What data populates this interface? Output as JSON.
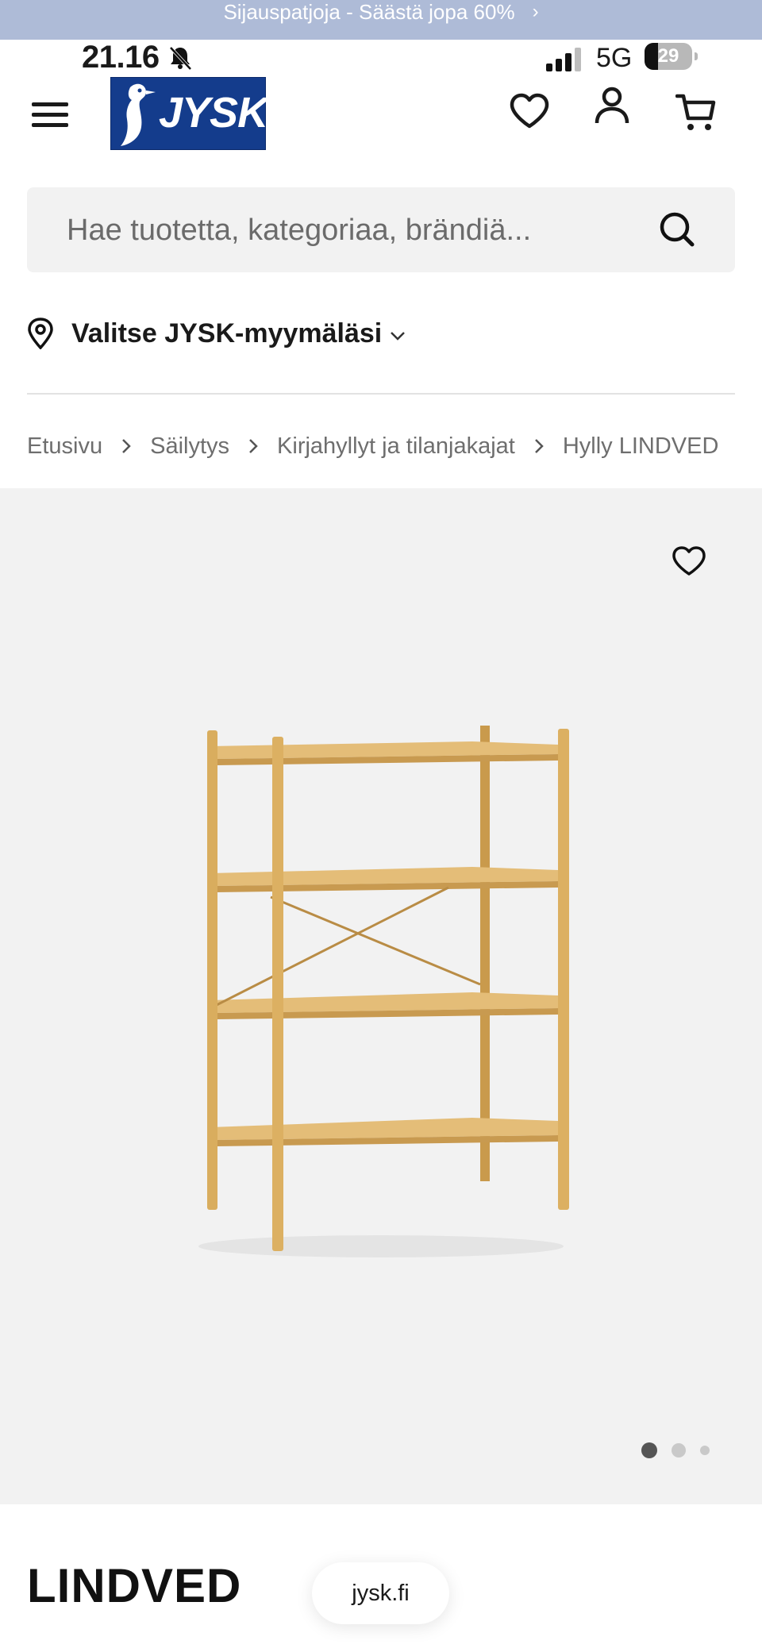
{
  "promo_banner": {
    "text": "Sijauspatjoja - Säästä jopa 60%",
    "chevron": "›"
  },
  "status_bar": {
    "time": "21.16",
    "network": "5G",
    "battery": "29"
  },
  "header": {
    "logo_text": "JYSK"
  },
  "search": {
    "placeholder": "Hae tuotetta, kategoriaa, brändiä..."
  },
  "store_selector": {
    "label": "Valitse JYSK-myymäläsi"
  },
  "breadcrumb": [
    "Etusivu",
    "Säilytys",
    "Kirjahyllyt ja tilanjakajat",
    "Hylly LINDVED"
  ],
  "gallery": {
    "slide_count": 3,
    "active_slide": 1
  },
  "product": {
    "title": "LINDVED"
  },
  "browser": {
    "url": "jysk.fi"
  },
  "colors": {
    "brand_blue": "#143c8c",
    "promo_bg": "#aebbd7",
    "gallery_bg": "#f2f2f2",
    "wood": "#d9ad5e"
  }
}
